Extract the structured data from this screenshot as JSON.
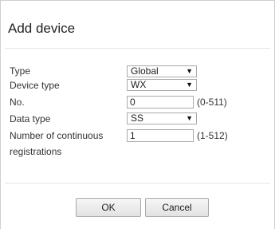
{
  "dialog": {
    "title": "Add device"
  },
  "form": {
    "type_label": "Type",
    "type_value": "Global",
    "device_type_label": "Device type",
    "device_type_value": "WX",
    "no_label": "No.",
    "no_value": "0",
    "no_hint": "(0-511)",
    "data_type_label": "Data type",
    "data_type_value": "SS",
    "continuous_label_line1": "Number of continuous",
    "continuous_label_line2": "registrations",
    "continuous_value": "1",
    "continuous_hint": "(1-512)"
  },
  "footer": {
    "ok_label": "OK",
    "cancel_label": "Cancel"
  },
  "icons": {
    "dropdown": "▼"
  }
}
